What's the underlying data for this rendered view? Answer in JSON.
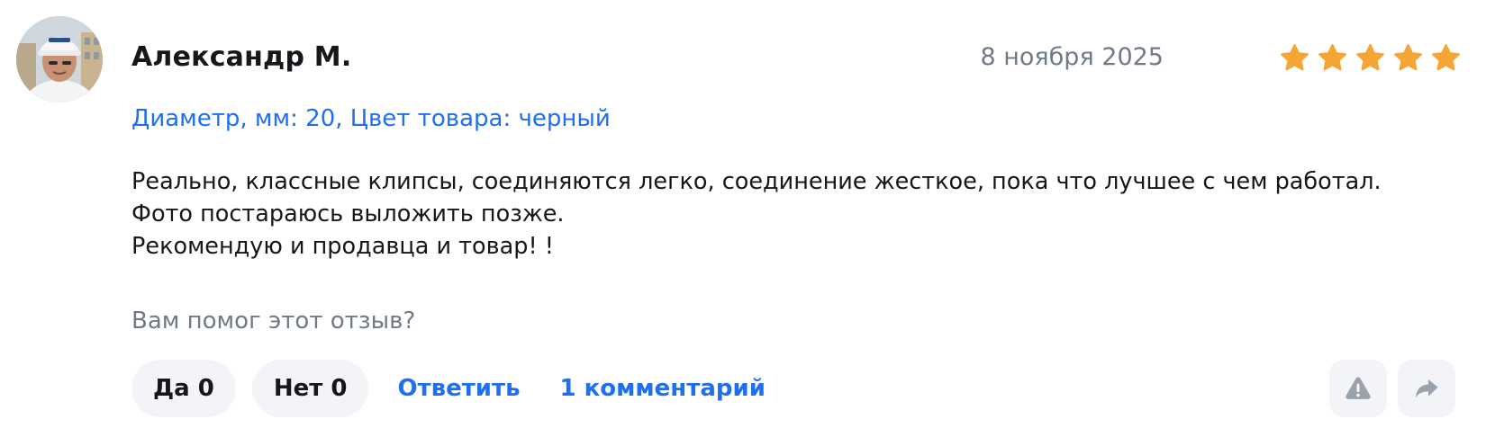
{
  "review": {
    "author": "Александр М.",
    "date": "8 ноября 2025",
    "rating": 5,
    "rating_max": 5,
    "star_color": "#f5a533",
    "variant": "Диаметр, мм: 20, Цвет товара: черный",
    "text_lines": [
      "Реально, классные клипсы, соединяются легко, соединение жесткое, пока что лучшее с чем работал.",
      "Фото постараюсь выложить позже.",
      "Рекомендую и продавца и товар! !"
    ]
  },
  "helpful": {
    "question": "Вам помог этот отзыв?",
    "yes_label": "Да 0",
    "no_label": "Нет 0",
    "reply_label": "Ответить",
    "comments_label": "1 комментарий"
  },
  "icons": {
    "avatar": "user-photo-avatar",
    "report": "warning-icon",
    "share": "share-arrow-icon"
  },
  "colors": {
    "link": "#1f6ff2",
    "muted": "#707a87",
    "button_bg": "#f2f4f7"
  }
}
